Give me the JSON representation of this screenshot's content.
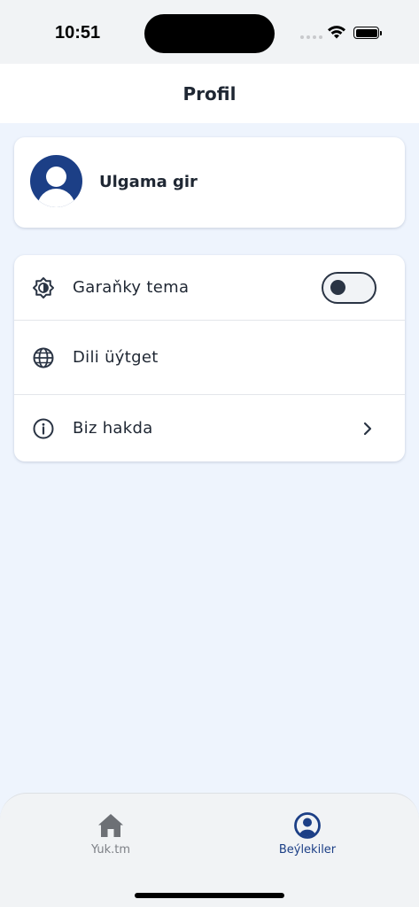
{
  "status_bar": {
    "time": "10:51"
  },
  "header": {
    "title": "Profil"
  },
  "profile": {
    "login_label": "Ulgama gir"
  },
  "settings": {
    "items": [
      {
        "label": "Garaňky tema",
        "icon": "dark-theme-icon",
        "control": "toggle",
        "toggle_on": false
      },
      {
        "label": "Dili üýtget",
        "icon": "globe-icon",
        "control": "none"
      },
      {
        "label": "Biz hakda",
        "icon": "info-icon",
        "control": "chevron"
      }
    ]
  },
  "bottom_nav": {
    "items": [
      {
        "label": "Yuk.tm",
        "icon": "home-icon",
        "active": false
      },
      {
        "label": "Beýlekiler",
        "icon": "profile-icon",
        "active": true
      }
    ]
  },
  "colors": {
    "accent": "#1c3f86",
    "background": "#eef4fd",
    "text": "#1f2733",
    "inactive": "#7d8086"
  }
}
